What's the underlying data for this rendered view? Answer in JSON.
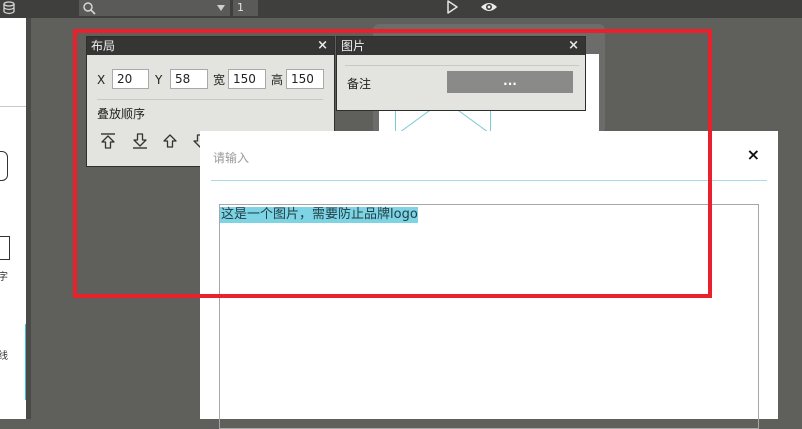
{
  "toolbar": {
    "page_number": "1"
  },
  "left_panel": {
    "label_zi": "字",
    "label_xian": "线"
  },
  "layout_panel": {
    "title": "布局",
    "close": "×",
    "x_label": "X",
    "x_value": "20",
    "y_label": "Y",
    "y_value": "58",
    "width_label": "宽",
    "width_value": "150",
    "height_label": "高",
    "height_value": "150",
    "order_label": "叠放顺序"
  },
  "image_panel": {
    "title": "图片",
    "close": "×",
    "note_label": "备注",
    "note_button": "..."
  },
  "dialog": {
    "placeholder_title": "请输入",
    "close": "×",
    "text": "这是一个图片，需要防止品牌logo"
  },
  "colors": {
    "highlight": "#7ed3e4",
    "annotation_box": "#e8212c",
    "accent": "#35c2d4"
  }
}
